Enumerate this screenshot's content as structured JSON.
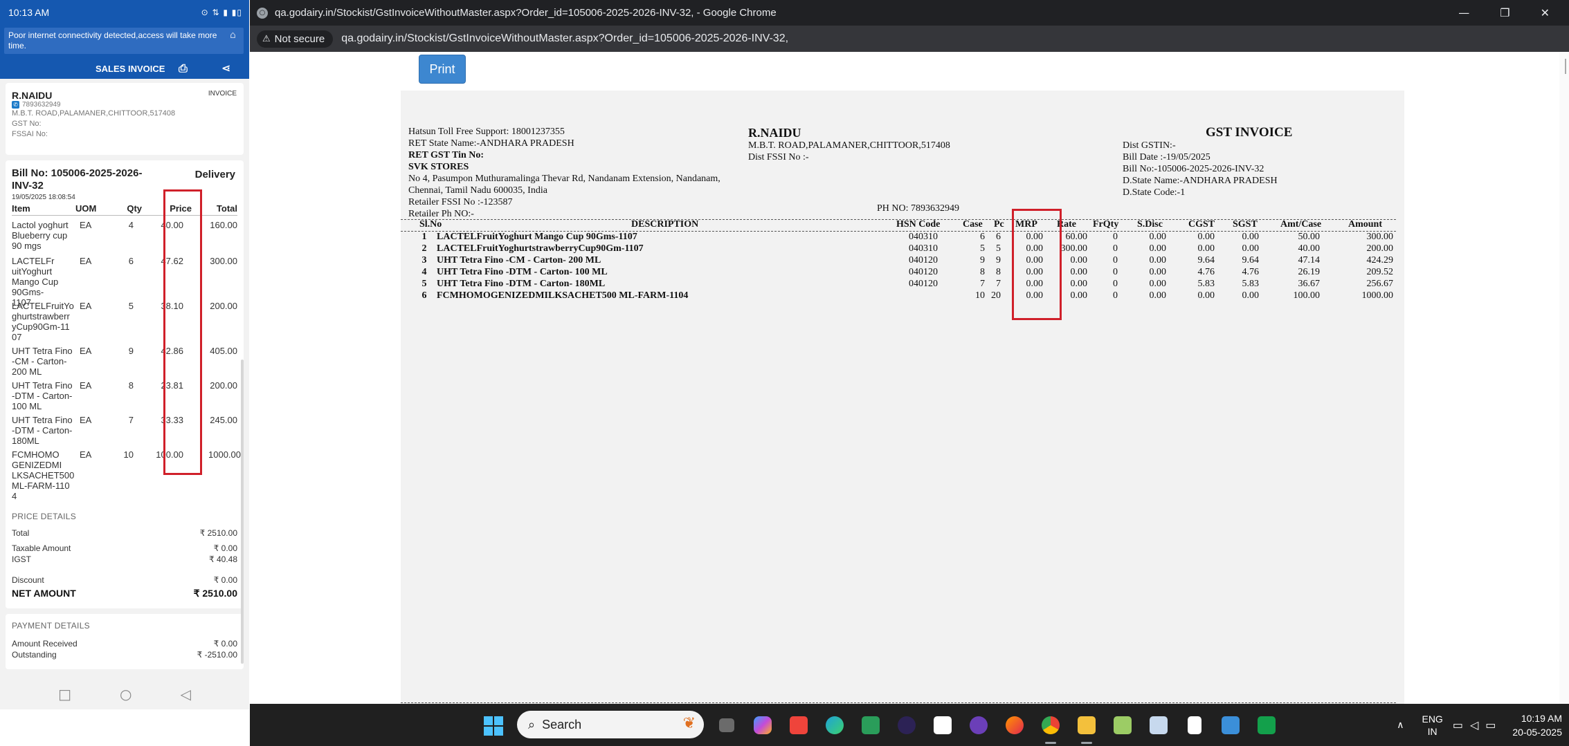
{
  "phone": {
    "status": {
      "time": "10:13 AM",
      "icons": "⊙ ⇅ ▮ ▮▯"
    },
    "alert": "Poor internet connectivity detected,access will take more time.",
    "header": {
      "title": "SALES INVOICE"
    },
    "customer": {
      "name": "R.NAIDU",
      "invoice_tag": "INVOICE",
      "phone": "7893632949",
      "address": "M.B.T. ROAD,PALAMANER,CHITTOOR,517408",
      "gst_no": "GST No:",
      "fssai_no": "FSSAI No:"
    },
    "bill": {
      "bill_no": "Bill No: 105006-2025-2026-INV-32",
      "delivery": "Delivery",
      "date": "19/05/2025 18:08:54",
      "headers": {
        "item": "Item",
        "uom": "UOM",
        "qty": "Qty",
        "price": "Price",
        "total": "Total"
      },
      "items": [
        {
          "item": "Lactol yoghurt Blueberry cup 90 mgs",
          "uom": "EA",
          "qty": "4",
          "price": "40.00",
          "total": "160.00"
        },
        {
          "item": "LACTELFr uitYoghurt Mango Cup 90Gms-1107",
          "uom": "EA",
          "qty": "6",
          "price": "47.62",
          "total": "300.00"
        },
        {
          "item": "LACTELFruitYo ghurtstrawberr yCup90Gm-11 07",
          "uom": "EA",
          "qty": "5",
          "price": "38.10",
          "total": "200.00"
        },
        {
          "item": "UHT Tetra Fino -CM - Carton- 200 ML",
          "uom": "EA",
          "qty": "9",
          "price": "42.86",
          "total": "405.00"
        },
        {
          "item": "UHT Tetra Fino -DTM - Carton- 100 ML",
          "uom": "EA",
          "qty": "8",
          "price": "23.81",
          "total": "200.00"
        },
        {
          "item": "UHT Tetra Fino -DTM - Carton- 180ML",
          "uom": "EA",
          "qty": "7",
          "price": "33.33",
          "total": "245.00"
        },
        {
          "item": "FCMHOMO GENIZEDMI LKSACHET500 ML-FARM-110 4",
          "uom": "EA",
          "qty": "10",
          "price": "100.00",
          "total": "1000.00"
        }
      ]
    },
    "price_details": {
      "title": "PRICE DETAILS",
      "total_label": "Total",
      "total_value": "₹ 2510.00",
      "taxable_label": "Taxable Amount",
      "taxable_value": "₹ 0.00",
      "igst_label": "IGST",
      "igst_value": "₹ 40.48",
      "discount_label": "Discount",
      "discount_value": "₹ 0.00",
      "net_label": "NET AMOUNT",
      "net_value": "₹ 2510.00"
    },
    "payment_details": {
      "title": "PAYMENT DETAILS",
      "received_label": "Amount Received",
      "received_value": "₹ 0.00",
      "outstanding_label": "Outstanding",
      "outstanding_value": "₹ -2510.00"
    }
  },
  "browser": {
    "window_title": "qa.godairy.in/Stockist/GstInvoiceWithoutMaster.aspx?Order_id=105006-2025-2026-INV-32, - Google Chrome",
    "not_secure": "Not secure",
    "url": "qa.godairy.in/Stockist/GstInvoiceWithoutMaster.aspx?Order_id=105006-2025-2026-INV-32,",
    "print_label": "Print"
  },
  "invoice": {
    "left": {
      "support": "Hatsun Toll Free Support: 18001237355",
      "ret_state": "RET State Name:-ANDHARA PRADESH",
      "ret_gst": "RET GST Tin No:",
      "store": "SVK STORES",
      "addr1": "No 4, Pasumpon Muthuramalinga Thevar Rd, Nandanam Extension, Nandanam,",
      "addr2": "Chennai, Tamil Nadu 600035, India",
      "fssai": "Retailer FSSI No :-123587",
      "phone": "Retailer Ph NO:-"
    },
    "middle": {
      "name": "R.NAIDU",
      "address": "M.B.T. ROAD,PALAMANER,CHITTOOR,517408",
      "fssi": "Dist FSSI No :-",
      "ph": "PH NO:  7893632949"
    },
    "right": {
      "title": "GST INVOICE",
      "gstin": "Dist GSTIN:-",
      "bill_date": "Bill Date :-19/05/2025",
      "bill_no": "Bill No:-105006-2025-2026-INV-32",
      "state": "D.State Name:-ANDHARA PRADESH",
      "state_code": "D.State Code:-1"
    },
    "headers": {
      "slno": "Sl.No",
      "desc": "DESCRIPTION",
      "hsn": "HSN Code",
      "case": "Case",
      "pc": "Pc",
      "mrp": "MRP",
      "rate": "Rate",
      "frqty": "FrQty",
      "sdisc": "S.Disc",
      "cgst": "CGST",
      "sgst": "SGST",
      "amtcase": "Amt/Case",
      "amount": "Amount"
    },
    "rows": [
      {
        "slno": "1",
        "desc": "LACTELFruitYoghurt Mango Cup 90Gms-1107",
        "hsn": "040310",
        "case": "6",
        "pc": "6",
        "mrp": "0.00",
        "rate": "60.00",
        "frqty": "0",
        "sdisc": "0.00",
        "cgst": "0.00",
        "sgst": "0.00",
        "amtcase": "50.00",
        "amount": "300.00"
      },
      {
        "slno": "2",
        "desc": "LACTELFruitYoghurtstrawberryCup90Gm-1107",
        "hsn": "040310",
        "case": "5",
        "pc": "5",
        "mrp": "0.00",
        "rate": "300.00",
        "frqty": "0",
        "sdisc": "0.00",
        "cgst": "0.00",
        "sgst": "0.00",
        "amtcase": "40.00",
        "amount": "200.00"
      },
      {
        "slno": "3",
        "desc": "UHT Tetra Fino -CM - Carton- 200 ML",
        "hsn": "040120",
        "case": "9",
        "pc": "9",
        "mrp": "0.00",
        "rate": "0.00",
        "frqty": "0",
        "sdisc": "0.00",
        "cgst": "9.64",
        "sgst": "9.64",
        "amtcase": "47.14",
        "amount": "424.29"
      },
      {
        "slno": "4",
        "desc": "UHT Tetra Fino -DTM - Carton- 100 ML",
        "hsn": "040120",
        "case": "8",
        "pc": "8",
        "mrp": "0.00",
        "rate": "0.00",
        "frqty": "0",
        "sdisc": "0.00",
        "cgst": "4.76",
        "sgst": "4.76",
        "amtcase": "26.19",
        "amount": "209.52"
      },
      {
        "slno": "5",
        "desc": "UHT Tetra Fino -DTM - Carton- 180ML",
        "hsn": "040120",
        "case": "7",
        "pc": "7",
        "mrp": "0.00",
        "rate": "0.00",
        "frqty": "0",
        "sdisc": "0.00",
        "cgst": "5.83",
        "sgst": "5.83",
        "amtcase": "36.67",
        "amount": "256.67"
      },
      {
        "slno": "6",
        "desc": "FCMHOMOGENIZEDMILKSACHET500 ML-FARM-1104",
        "hsn": "",
        "case": "10",
        "pc": "20",
        "mrp": "0.00",
        "rate": "0.00",
        "frqty": "0",
        "sdisc": "0.00",
        "cgst": "0.00",
        "sgst": "0.00",
        "amtcase": "100.00",
        "amount": "1000.00"
      }
    ]
  },
  "taskbar": {
    "search": "Search",
    "lang1": "ENG",
    "lang2": "IN",
    "time": "10:19 AM",
    "date": "20-05-2025"
  },
  "colors": {
    "highlight_red": "#d0202a",
    "app_blue": "#1558b0",
    "print_blue": "#3d87d0"
  }
}
